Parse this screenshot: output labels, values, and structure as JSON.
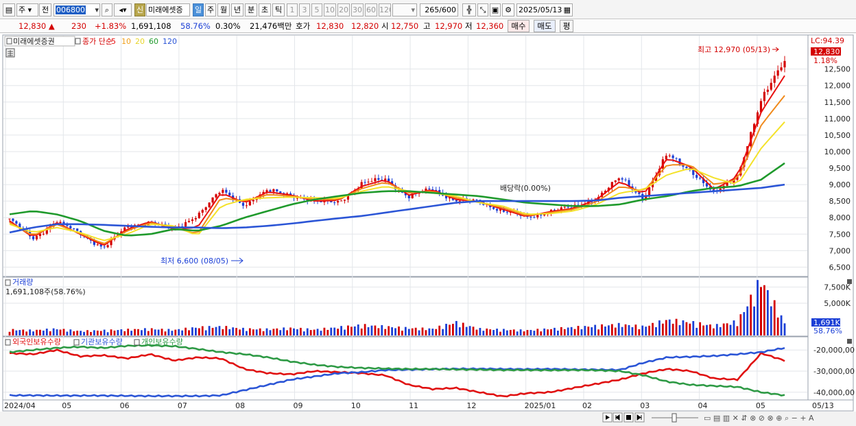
{
  "toolbar": {
    "market": "주",
    "prev": "전",
    "code": "006800",
    "stock_badge": "신",
    "stock_name": "미래에셋증",
    "periods": [
      "일",
      "주",
      "월",
      "년",
      "분",
      "초",
      "틱"
    ],
    "active_period": "일",
    "intervals": [
      "1",
      "3",
      "5",
      "10",
      "20",
      "30",
      "60",
      "120"
    ],
    "count": "265",
    "count_total": "/600",
    "date": "2025/05/13"
  },
  "quote": {
    "price": "12,830",
    "change_arrow": "▲",
    "change": "230",
    "change_pct": "+1.83%",
    "volume": "1,691,108",
    "volume_ratio": "58.76%",
    "turnover_pct": "0.30%",
    "trade_value": "21,476백만",
    "hoga_label": "호가",
    "ask": "12,830",
    "bid": "12,820",
    "open_label": "시",
    "open": "12,750",
    "high_label": "고",
    "high": "12,970",
    "low_label": "저",
    "low": "12,360",
    "buy_label": "매수",
    "sell_label": "매도",
    "avg_label": "평"
  },
  "legend": {
    "stock": "미래에셋증권",
    "ma_label": "종가 단순",
    "ma_periods": [
      "5",
      "10",
      "20",
      "60",
      "120"
    ]
  },
  "annotations": {
    "high_text": "최고 12,970 (05/13)",
    "low_text": "최저 6,600 (08/05)",
    "dividend_text": "배당락(0.00%)",
    "lc_text": "LC:94.39",
    "last_price_tag": "12,830",
    "last_pct_tag": "1.18%"
  },
  "volume_panel": {
    "title": "거래량",
    "value_text": "1,691,108주(58.76%)",
    "last_tag": "1,691K",
    "last_pct_tag": "58.76%"
  },
  "holdings_panel": {
    "series_labels": [
      "외국인보유수량",
      "기관보유수량",
      "개인보유수량"
    ]
  },
  "colors": {
    "up": "#d40000",
    "down": "#1b3fd6",
    "ma5": "#e81010",
    "ma10": "#f08a1c",
    "ma20": "#f4e22a",
    "ma60": "#1f9a2c",
    "ma120": "#2b55d6",
    "foreign": "#e01010",
    "institution": "#2b55d6",
    "individual": "#2e9a45"
  },
  "chart_data": [
    {
      "type": "line",
      "title": "",
      "ylabel": "",
      "ylim": [
        6300,
        13200
      ],
      "y_ticks": [
        "6,500",
        "7,000",
        "7,500",
        "8,000",
        "8,500",
        "9,000",
        "9,500",
        "10,000",
        "10,500",
        "11,000",
        "11,500",
        "12,000",
        "12,500"
      ],
      "x": [
        "2024/04",
        "05",
        "06",
        "07",
        "08",
        "09",
        "10",
        "11",
        "12",
        "2025/01",
        "02",
        "03",
        "04",
        "05",
        "05/13"
      ],
      "series": [
        {
          "name": "종가",
          "values": [
            7950,
            7350,
            7900,
            7500,
            7100,
            7700,
            7900,
            7600,
            8100,
            8800,
            8400,
            8800,
            8700,
            8450,
            8500,
            9000,
            9200,
            8600,
            8900,
            8500,
            8500,
            8200,
            8000,
            8200,
            8300,
            8600,
            9200,
            8600,
            9900,
            9450,
            8700,
            9300,
            11500,
            12830
          ]
        },
        {
          "name": "5",
          "values": [
            7900,
            7400,
            7850,
            7500,
            7150,
            7650,
            7880,
            7650,
            7700,
            8750,
            8450,
            8780,
            8680,
            8500,
            8520,
            8950,
            9150,
            8680,
            8850,
            8550,
            8480,
            8250,
            8030,
            8180,
            8280,
            8550,
            9100,
            8700,
            9800,
            9550,
            8850,
            9250,
            11200,
            12300
          ]
        },
        {
          "name": "10",
          "values": [
            7850,
            7450,
            7800,
            7520,
            7200,
            7600,
            7850,
            7700,
            7500,
            8600,
            8500,
            8700,
            8650,
            8550,
            8550,
            8880,
            9080,
            8750,
            8800,
            8600,
            8460,
            8300,
            8060,
            8150,
            8250,
            8480,
            8950,
            8800,
            9600,
            9600,
            9000,
            9150,
            10800,
            11700
          ]
        },
        {
          "name": "20",
          "values": [
            7800,
            7550,
            7700,
            7550,
            7300,
            7500,
            7800,
            7750,
            7450,
            8350,
            8550,
            8600,
            8620,
            8600,
            8580,
            8800,
            8950,
            8800,
            8750,
            8650,
            8450,
            8350,
            8100,
            8120,
            8200,
            8400,
            8750,
            8850,
            9300,
            9500,
            9200,
            9000,
            10100,
            10900
          ]
        },
        {
          "name": "60",
          "values": [
            8100,
            8200,
            8100,
            7900,
            7600,
            7450,
            7500,
            7650,
            7600,
            7750,
            8000,
            8200,
            8400,
            8550,
            8650,
            8750,
            8800,
            8800,
            8750,
            8700,
            8650,
            8550,
            8450,
            8400,
            8350,
            8350,
            8400,
            8550,
            8650,
            8800,
            8900,
            8950,
            9150,
            9650
          ]
        },
        {
          "name": "120",
          "values": [
            7550,
            7700,
            7800,
            7800,
            7780,
            7750,
            7720,
            7700,
            7700,
            7680,
            7700,
            7750,
            7820,
            7900,
            7980,
            8050,
            8150,
            8250,
            8350,
            8450,
            8500,
            8500,
            8500,
            8500,
            8500,
            8520,
            8600,
            8650,
            8700,
            8750,
            8800,
            8850,
            8900,
            9000
          ]
        }
      ]
    },
    {
      "type": "bar",
      "title": "거래량",
      "ylim": [
        0,
        8500000
      ],
      "y_ticks": [
        "5,000K",
        "7,500K"
      ],
      "values": [
        800000,
        700000,
        900000,
        600000,
        700000,
        800000,
        900000,
        750000,
        1100000,
        1200000,
        900000,
        850000,
        1000000,
        800000,
        1100000,
        1400000,
        1200000,
        1000000,
        900000,
        1800000,
        900000,
        800000,
        700000,
        900000,
        1100000,
        1300000,
        1500000,
        1200000,
        2100000,
        1800000,
        1300000,
        1900000,
        7500000,
        1691108
      ]
    },
    {
      "type": "line",
      "title": "",
      "ylim": [
        -43000000,
        -17000000
      ],
      "y_ticks": [
        "-20,000,00",
        "-30,000,00",
        "-40,000,00"
      ],
      "series": [
        {
          "name": "외국인보유수량",
          "values": [
            -21500000,
            -22000000,
            -20000000,
            -23000000,
            -22500000,
            -24000000,
            -22000000,
            -25000000,
            -23500000,
            -24000000,
            -29000000,
            -31000000,
            -31500000,
            -30000000,
            -30500000,
            -31000000,
            -32000000,
            -36500000,
            -38500000,
            -38000000,
            -40000000,
            -42000000,
            -40500000,
            -40000000,
            -38000000,
            -36000000,
            -34000000,
            -31000000,
            -29000000,
            -30000000,
            -33500000,
            -34000000,
            -21500000,
            -25000000
          ]
        },
        {
          "name": "기관보유수량",
          "values": [
            -41500000,
            -41500000,
            -41600000,
            -41600000,
            -41600000,
            -41700000,
            -41800000,
            -41800000,
            -41800000,
            -41500000,
            -39000000,
            -36500000,
            -34000000,
            -32500000,
            -31000000,
            -30500000,
            -29500000,
            -29300000,
            -29100000,
            -28900000,
            -28900000,
            -29000000,
            -29100000,
            -29000000,
            -29200000,
            -29300000,
            -29400000,
            -26000000,
            -23500000,
            -23200000,
            -22800000,
            -22000000,
            -21000000,
            -19000000
          ]
        },
        {
          "name": "개인보유수량",
          "values": [
            -21000000,
            -20000000,
            -19000000,
            -18500000,
            -19000000,
            -18000000,
            -17800000,
            -18200000,
            -19500000,
            -21000000,
            -22000000,
            -23500000,
            -25500000,
            -27000000,
            -28000000,
            -28500000,
            -28800000,
            -29000000,
            -29000000,
            -29200000,
            -29300000,
            -29500000,
            -29500000,
            -29600000,
            -29500000,
            -29600000,
            -30000000,
            -32000000,
            -35000000,
            -36500000,
            -37000000,
            -37500000,
            -40000000,
            -41500000
          ]
        }
      ]
    }
  ]
}
